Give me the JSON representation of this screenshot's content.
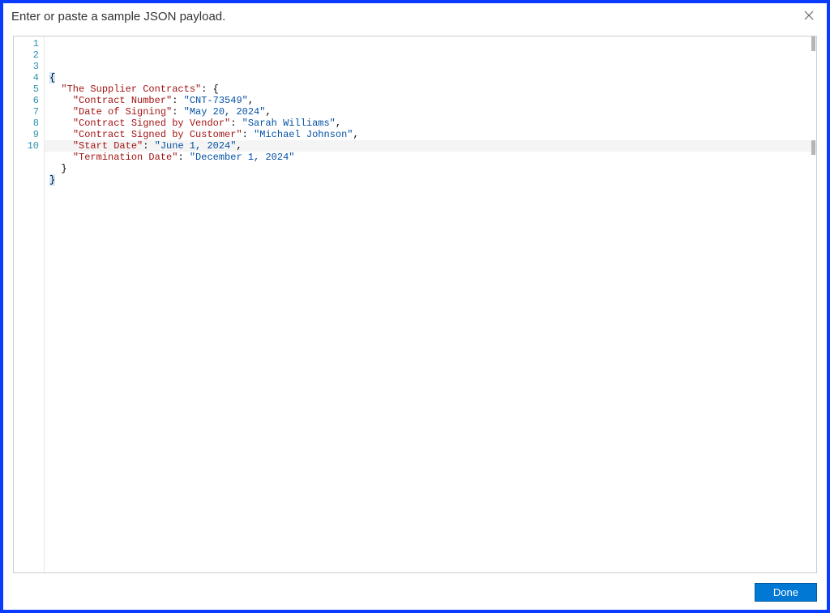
{
  "dialog": {
    "title": "Enter or paste a sample JSON payload.",
    "done_label": "Done"
  },
  "editor": {
    "line_numbers": [
      "1",
      "2",
      "3",
      "4",
      "5",
      "6",
      "7",
      "8",
      "9",
      "10"
    ],
    "lines": [
      {
        "indent": 0,
        "tokens": [
          {
            "t": "{",
            "c": "brace",
            "sel": true
          }
        ]
      },
      {
        "indent": 1,
        "tokens": [
          {
            "t": "\"The Supplier Contracts\"",
            "c": "key"
          },
          {
            "t": ": ",
            "c": "colon"
          },
          {
            "t": "{",
            "c": "brace"
          }
        ]
      },
      {
        "indent": 2,
        "tokens": [
          {
            "t": "\"Contract Number\"",
            "c": "key"
          },
          {
            "t": ": ",
            "c": "colon"
          },
          {
            "t": "\"CNT-73549\"",
            "c": "str"
          },
          {
            "t": ",",
            "c": "punc"
          }
        ]
      },
      {
        "indent": 2,
        "tokens": [
          {
            "t": "\"Date of Signing\"",
            "c": "key"
          },
          {
            "t": ": ",
            "c": "colon"
          },
          {
            "t": "\"May 20, 2024\"",
            "c": "str"
          },
          {
            "t": ",",
            "c": "punc"
          }
        ]
      },
      {
        "indent": 2,
        "tokens": [
          {
            "t": "\"Contract Signed by Vendor\"",
            "c": "key"
          },
          {
            "t": ": ",
            "c": "colon"
          },
          {
            "t": "\"Sarah Williams\"",
            "c": "str"
          },
          {
            "t": ",",
            "c": "punc"
          }
        ]
      },
      {
        "indent": 2,
        "tokens": [
          {
            "t": "\"Contract Signed by Customer\"",
            "c": "key"
          },
          {
            "t": ": ",
            "c": "colon"
          },
          {
            "t": "\"Michael Johnson\"",
            "c": "str"
          },
          {
            "t": ",",
            "c": "punc"
          }
        ]
      },
      {
        "indent": 2,
        "tokens": [
          {
            "t": "\"Start Date\"",
            "c": "key"
          },
          {
            "t": ": ",
            "c": "colon"
          },
          {
            "t": "\"June 1, 2024\"",
            "c": "str"
          },
          {
            "t": ",",
            "c": "punc"
          }
        ]
      },
      {
        "indent": 2,
        "tokens": [
          {
            "t": "\"Termination Date\"",
            "c": "key"
          },
          {
            "t": ": ",
            "c": "colon"
          },
          {
            "t": "\"December 1, 2024\"",
            "c": "str"
          }
        ]
      },
      {
        "indent": 1,
        "tokens": [
          {
            "t": "}",
            "c": "brace"
          }
        ]
      },
      {
        "indent": 0,
        "tokens": [
          {
            "t": "}",
            "c": "brace",
            "sel": true
          }
        ]
      }
    ]
  }
}
